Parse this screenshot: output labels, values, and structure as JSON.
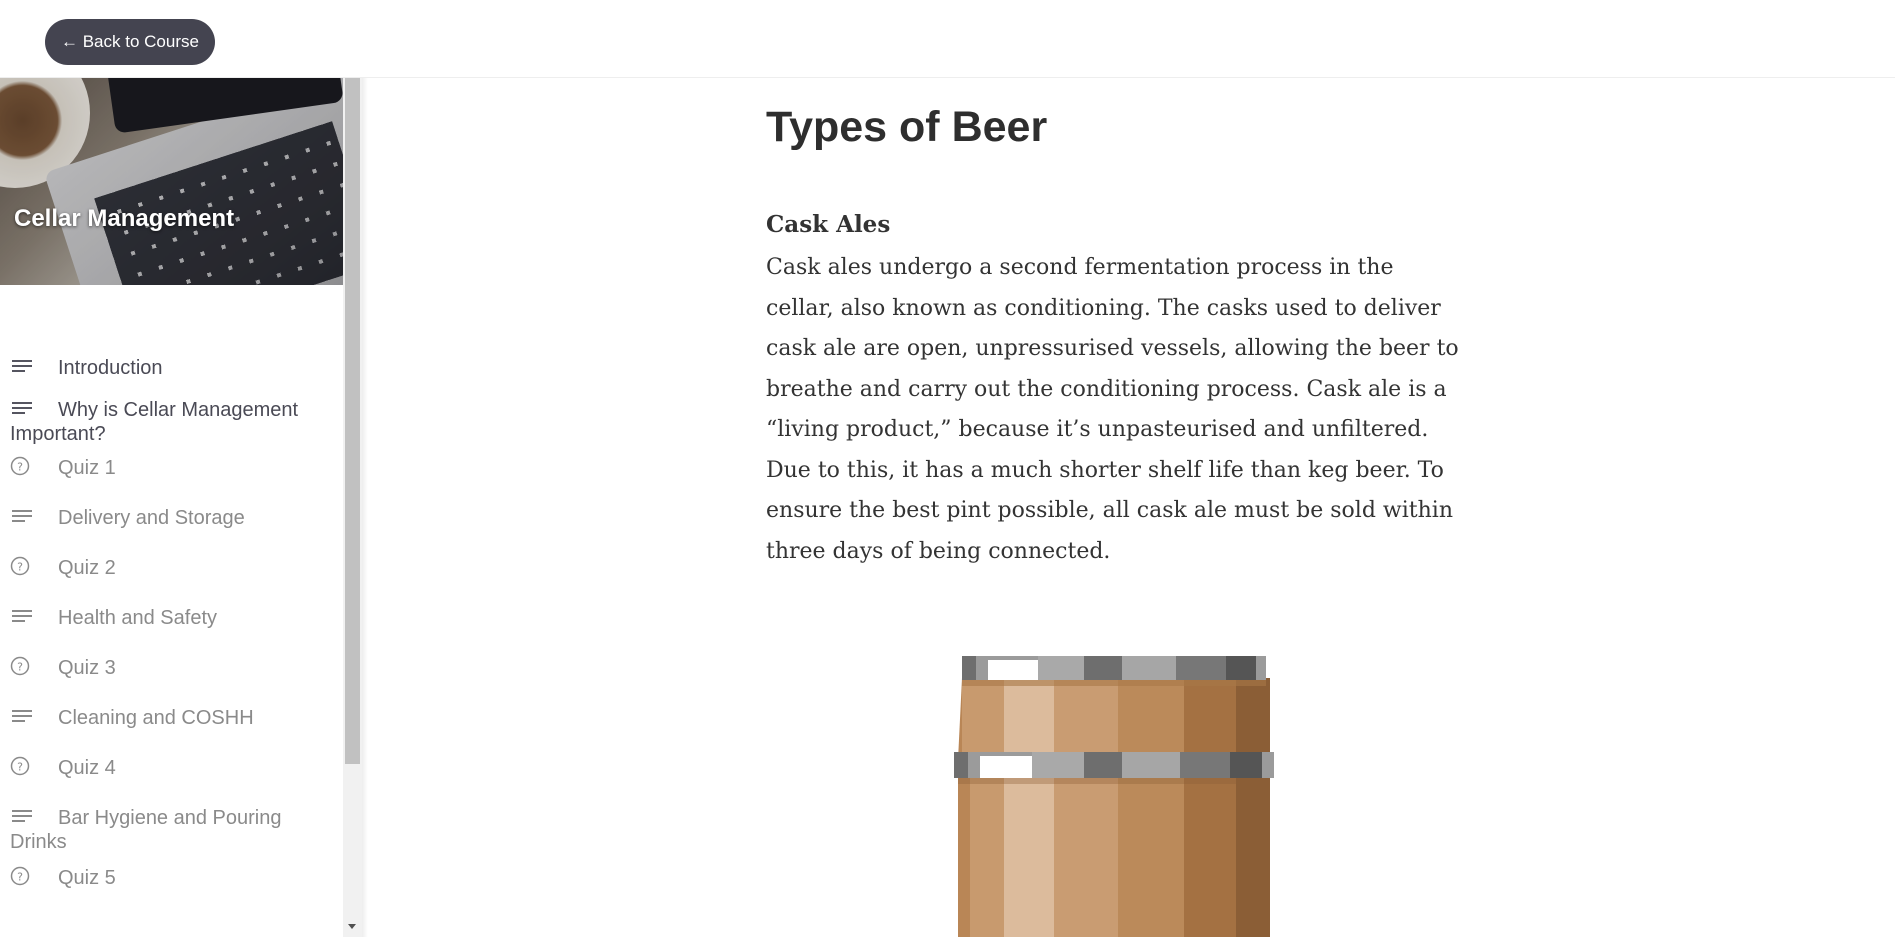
{
  "topbar": {
    "back_label": "← Back to Course"
  },
  "sidebar": {
    "course_title": "Cellar Management",
    "items": [
      {
        "label": "Introduction",
        "icon": "text-lines-icon",
        "state": "visited"
      },
      {
        "label": "Why is Cellar Management Important?",
        "icon": "text-lines-icon",
        "state": "visited"
      },
      {
        "label": "Quiz 1",
        "icon": "question-circle-icon",
        "state": "unvisited"
      },
      {
        "label": "Delivery and Storage",
        "icon": "text-lines-icon",
        "state": "unvisited"
      },
      {
        "label": "Quiz 2",
        "icon": "question-circle-icon",
        "state": "unvisited"
      },
      {
        "label": "Health and Safety",
        "icon": "text-lines-icon",
        "state": "unvisited"
      },
      {
        "label": "Quiz 3",
        "icon": "question-circle-icon",
        "state": "unvisited"
      },
      {
        "label": "Cleaning and COSHH",
        "icon": "text-lines-icon",
        "state": "unvisited"
      },
      {
        "label": "Quiz 4",
        "icon": "question-circle-icon",
        "state": "unvisited"
      },
      {
        "label": "Bar Hygiene and Pouring Drinks",
        "icon": "text-lines-icon",
        "state": "unvisited"
      },
      {
        "label": "Quiz 5",
        "icon": "question-circle-icon",
        "state": "unvisited"
      }
    ]
  },
  "main": {
    "title": "Types of Beer",
    "section_heading": "Cask Ales",
    "section_body": "Cask ales undergo a second fermentation process in the cellar, also known as conditioning. The casks used to deliver cask ale are open, unpressurised vessels, allowing the beer to breathe and carry out the conditioning process. Cask ale is a “living product,” because it’s unpasteurised and unfiltered. Due to this, it has a much shorter shelf life than keg beer. To ensure the best pint possible, all cask ale must be sold within three days of being connected.",
    "illustration": "barrel-illustration"
  },
  "colors": {
    "button_bg": "#444450",
    "nav_visited": "#4a4a55",
    "nav_unvisited": "#8a8a8a",
    "text": "#333333"
  }
}
